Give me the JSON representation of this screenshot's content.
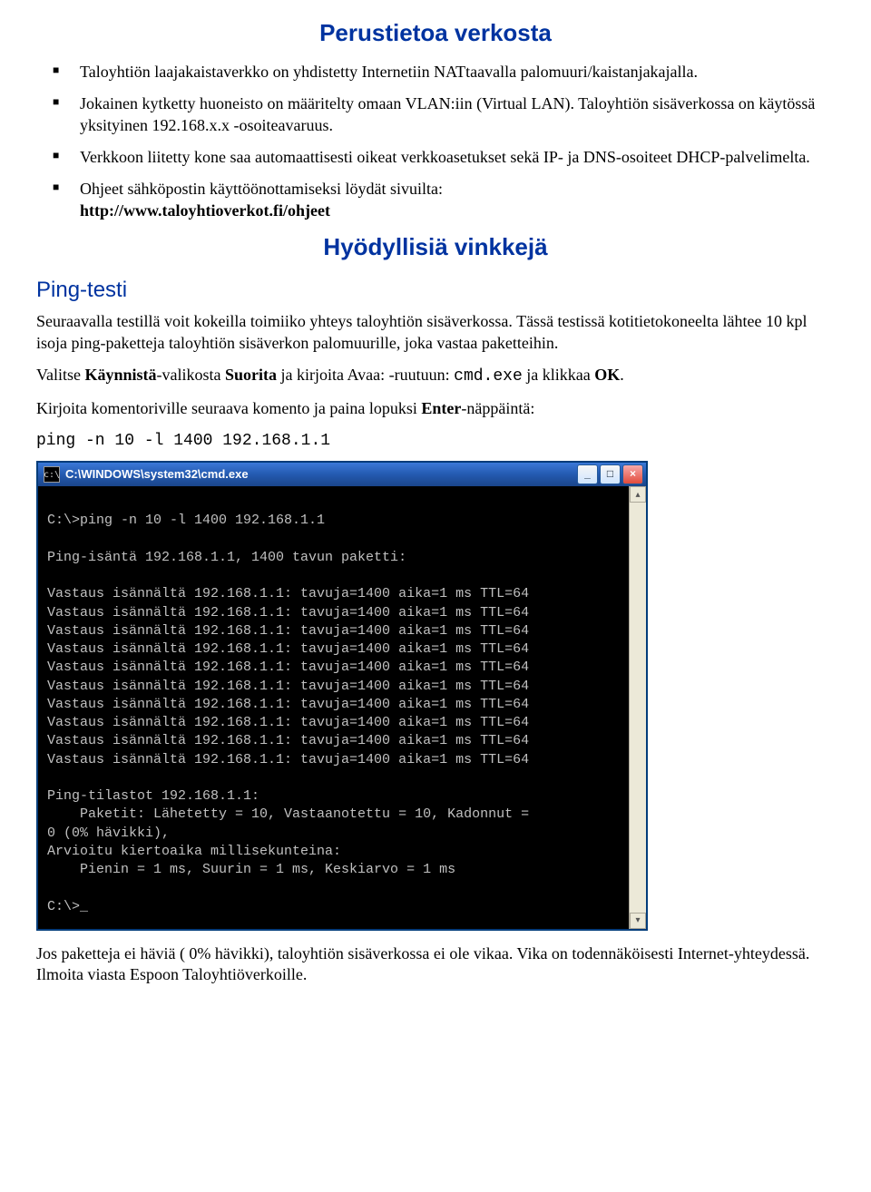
{
  "title_main": "Perustietoa verkosta",
  "bullets": [
    {
      "text": "Taloyhtiön laajakaistaverkko on yhdistetty Internetiin NATtaavalla palomuuri/kaistanjakajalla."
    },
    {
      "text": "Jokainen kytketty huoneisto on määritelty omaan VLAN:iin (Virtual LAN). Taloyhtiön sisäverkossa on käytössä yksityinen 192.168.x.x -osoiteavaruus."
    },
    {
      "text": "Verkkoon liitetty kone saa automaattisesti oikeat verkkoasetukset sekä IP- ja DNS-osoiteet DHCP-palvelimelta."
    },
    {
      "prefix": "Ohjeet sähköpostin käyttöönottamiseksi löydät sivuilta:",
      "link": "http://www.taloyhtioverkot.fi/ohjeet"
    }
  ],
  "title_tips": "Hyödyllisiä vinkkejä",
  "section_ping": "Ping-testi",
  "para1": "Seuraavalla testillä voit kokeilla toimiiko yhteys taloyhtiön sisäverkossa. Tässä testissä kotitietokoneelta lähtee 10 kpl isoja ping-paketteja taloyhtiön sisäverkon palomuurille, joka vastaa paketteihin.",
  "para2": {
    "t1": "Valitse ",
    "b1": "Käynnistä",
    "t2": "-valikosta ",
    "b2": "Suorita",
    "t3": " ja kirjoita Avaa: -ruutuun: ",
    "code": "cmd.exe",
    "t4": " ja klikkaa ",
    "b3": "OK",
    "t5": "."
  },
  "para3": {
    "t1": "Kirjoita komentoriville seuraava komento ja paina lopuksi ",
    "b1": "Enter",
    "t2": "-näppäintä:"
  },
  "command": "ping -n 10 -l 1400 192.168.1.1",
  "terminal": {
    "title": "C:\\WINDOWS\\system32\\cmd.exe",
    "icon_text": "c:\\",
    "lines": [
      "",
      "C:\\>ping -n 10 -l 1400 192.168.1.1",
      "",
      "Ping-isäntä 192.168.1.1, 1400 tavun paketti:",
      "",
      "Vastaus isännältä 192.168.1.1: tavuja=1400 aika=1 ms TTL=64",
      "Vastaus isännältä 192.168.1.1: tavuja=1400 aika=1 ms TTL=64",
      "Vastaus isännältä 192.168.1.1: tavuja=1400 aika=1 ms TTL=64",
      "Vastaus isännältä 192.168.1.1: tavuja=1400 aika=1 ms TTL=64",
      "Vastaus isännältä 192.168.1.1: tavuja=1400 aika=1 ms TTL=64",
      "Vastaus isännältä 192.168.1.1: tavuja=1400 aika=1 ms TTL=64",
      "Vastaus isännältä 192.168.1.1: tavuja=1400 aika=1 ms TTL=64",
      "Vastaus isännältä 192.168.1.1: tavuja=1400 aika=1 ms TTL=64",
      "Vastaus isännältä 192.168.1.1: tavuja=1400 aika=1 ms TTL=64",
      "Vastaus isännältä 192.168.1.1: tavuja=1400 aika=1 ms TTL=64",
      "",
      "Ping-tilastot 192.168.1.1:",
      "    Paketit: Lähetetty = 10, Vastaanotettu = 10, Kadonnut =",
      "0 (0% hävikki),",
      "Arvioitu kiertoaika millisekunteina:",
      "    Pienin = 1 ms, Suurin = 1 ms, Keskiarvo = 1 ms",
      "",
      "C:\\>_"
    ]
  },
  "para_final": "Jos paketteja ei häviä ( 0% hävikki), taloyhtiön sisäverkossa ei ole vikaa. Vika on todennäköisesti Internet-yhteydessä. Ilmoita viasta Espoon Taloyhtiöverkoille."
}
